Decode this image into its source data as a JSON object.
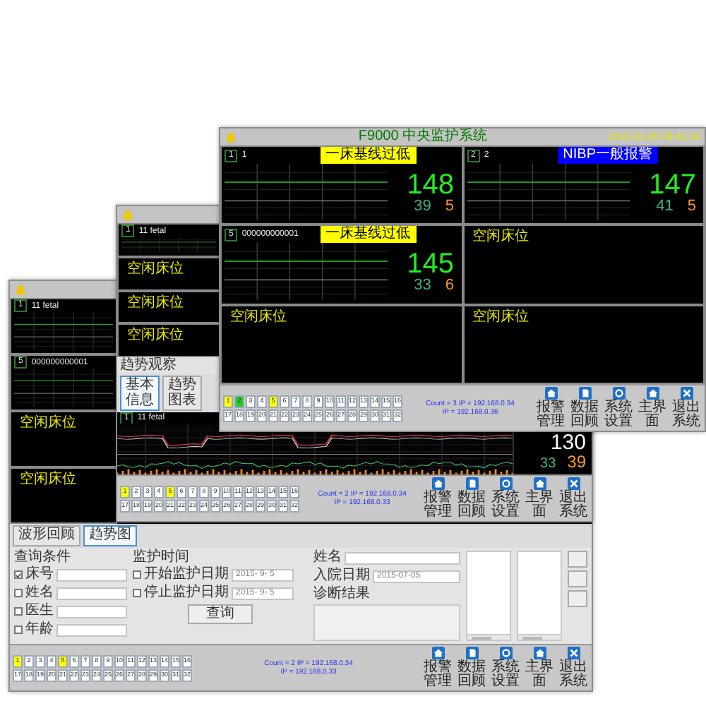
{
  "review_window": {
    "monitor_list": [
      {
        "kind": "active",
        "bed": "1",
        "patient": "11 fetal"
      },
      {
        "kind": "active",
        "bed": "5",
        "patient": "000000000001"
      },
      {
        "kind": "idle",
        "label": "空闲床位"
      },
      {
        "kind": "idle",
        "label": "空闲床位"
      }
    ],
    "tabs": [
      {
        "label": "波形回顾",
        "selected": false
      },
      {
        "label": "趋势图",
        "selected": true
      }
    ],
    "query": {
      "title": "查询条件",
      "fields": [
        {
          "label": "床号",
          "checked": true
        },
        {
          "label": "姓名",
          "checked": false
        },
        {
          "label": "医生",
          "checked": false
        },
        {
          "label": "年龄",
          "checked": false
        }
      ],
      "time_title": "监护时间",
      "dates": [
        {
          "label": "开始监护日期",
          "checked": false,
          "value": "2015- 9- 5"
        },
        {
          "label": "停止监护日期",
          "checked": false,
          "value": "2015- 9- 5"
        }
      ],
      "button": "查询"
    },
    "patient_info": {
      "name_label": "姓名",
      "admit_label": "入院日期",
      "admit_value": "2015-07-05",
      "diagnosis_label": "诊断结果"
    },
    "bed_grid": [
      {
        "label": "1",
        "color": "#ffff00"
      },
      {
        "label": "2",
        "color": "#ffffff"
      },
      {
        "label": "3",
        "color": "#ffffff"
      },
      {
        "label": "4",
        "color": "#ffffff"
      },
      {
        "label": "5",
        "color": "#ffff00"
      },
      {
        "label": "6",
        "color": "#ffffff"
      },
      {
        "label": "7",
        "color": "#ffffff"
      },
      {
        "label": "8",
        "color": "#ffffff"
      },
      {
        "label": "9",
        "color": "#ffffff"
      },
      {
        "label": "10",
        "color": "#ffffff"
      },
      {
        "label": "11",
        "color": "#ffffff"
      },
      {
        "label": "12",
        "color": "#ffffff"
      },
      {
        "label": "13",
        "color": "#ffffff"
      },
      {
        "label": "14",
        "color": "#ffffff"
      },
      {
        "label": "15",
        "color": "#ffffff"
      },
      {
        "label": "16",
        "color": "#ffffff"
      },
      {
        "label": "17",
        "color": "#ffffff"
      },
      {
        "label": "18",
        "color": "#ffffff"
      },
      {
        "label": "19",
        "color": "#ffffff"
      },
      {
        "label": "20",
        "color": "#ffffff"
      },
      {
        "label": "21",
        "color": "#ffffff"
      },
      {
        "label": "22",
        "color": "#ffffff"
      },
      {
        "label": "23",
        "color": "#ffffff"
      },
      {
        "label": "24",
        "color": "#ffffff"
      },
      {
        "label": "25",
        "color": "#ffffff"
      },
      {
        "label": "26",
        "color": "#ffffff"
      },
      {
        "label": "27",
        "color": "#ffffff"
      },
      {
        "label": "28",
        "color": "#ffffff"
      },
      {
        "label": "29",
        "color": "#ffffff"
      },
      {
        "label": "30",
        "color": "#ffffff"
      },
      {
        "label": "31",
        "color": "#ffffff"
      },
      {
        "label": "32",
        "color": "#ffffff"
      }
    ],
    "status": [
      "Count = 2 IP = 192.168.0.34",
      "IP = 192.168.0.33"
    ],
    "buttons": [
      "报警管理",
      "数据回顾",
      "系统设置",
      "主界面",
      "退出系统"
    ]
  },
  "trend_window": {
    "monitor_list": [
      {
        "kind": "active",
        "bed": "1",
        "patient": "11 fetal"
      },
      {
        "kind": "idle",
        "label": "空闲床位"
      },
      {
        "kind": "idle",
        "label": "空闲床位"
      },
      {
        "kind": "idle",
        "label": "空闲床位"
      }
    ],
    "section_title": "趋势观察",
    "tabs": [
      {
        "label": "基本信息",
        "selected": true
      },
      {
        "label": "趋势图表",
        "selected": false
      }
    ],
    "chart_header": {
      "bed": "1",
      "patient": "11 fetal"
    },
    "readout": {
      "fhr": "130",
      "toco": "33",
      "fm": "39"
    },
    "bed_grid": [
      {
        "label": "1",
        "color": "#ffff00"
      },
      {
        "label": "2",
        "color": "#ffffff"
      },
      {
        "label": "3",
        "color": "#ffffff"
      },
      {
        "label": "4",
        "color": "#ffffff"
      },
      {
        "label": "5",
        "color": "#ffff00"
      },
      {
        "label": "6",
        "color": "#ffffff"
      },
      {
        "label": "7",
        "color": "#ffffff"
      },
      {
        "label": "8",
        "color": "#ffffff"
      },
      {
        "label": "9",
        "color": "#ffffff"
      },
      {
        "label": "10",
        "color": "#ffffff"
      },
      {
        "label": "11",
        "color": "#ffffff"
      },
      {
        "label": "12",
        "color": "#ffffff"
      },
      {
        "label": "13",
        "color": "#ffffff"
      },
      {
        "label": "14",
        "color": "#ffffff"
      },
      {
        "label": "15",
        "color": "#ffffff"
      },
      {
        "label": "16",
        "color": "#ffffff"
      },
      {
        "label": "17",
        "color": "#ffffff"
      },
      {
        "label": "18",
        "color": "#ffffff"
      },
      {
        "label": "19",
        "color": "#ffffff"
      },
      {
        "label": "20",
        "color": "#ffffff"
      },
      {
        "label": "21",
        "color": "#ffffff"
      },
      {
        "label": "22",
        "color": "#ffffff"
      },
      {
        "label": "23",
        "color": "#ffffff"
      },
      {
        "label": "24",
        "color": "#ffffff"
      },
      {
        "label": "25",
        "color": "#ffffff"
      },
      {
        "label": "26",
        "color": "#ffffff"
      },
      {
        "label": "27",
        "color": "#ffffff"
      },
      {
        "label": "28",
        "color": "#ffffff"
      },
      {
        "label": "29",
        "color": "#ffffff"
      },
      {
        "label": "30",
        "color": "#ffffff"
      },
      {
        "label": "31",
        "color": "#ffffff"
      },
      {
        "label": "32",
        "color": "#ffffff"
      }
    ],
    "status": [
      "Count = 2 IP = 192.168.0.34",
      "IP = 192.168.0.33"
    ],
    "buttons": [
      "报警管理",
      "数据回顾",
      "系统设置",
      "主界面",
      "退出系统"
    ]
  },
  "central_window": {
    "title": "F9000 中央监护系统",
    "datetime": "2015-01-05 09:41:34",
    "beds": [
      {
        "kind": "active",
        "bed": "1",
        "patient": "1",
        "alarm": "一床基线过低",
        "color": "#ffff00",
        "fhr": "148",
        "toco": "39",
        "fm": "5"
      },
      {
        "kind": "active",
        "bed": "2",
        "patient": "2",
        "alarm": "NIBP一般报警",
        "color": "#0000ff",
        "fhr": "147",
        "toco": "41",
        "fm": "5"
      },
      {
        "kind": "active",
        "bed": "5",
        "patient": "000000000001",
        "alarm": "一床基线过低",
        "color": "#ffff00",
        "fhr": "145",
        "toco": "33",
        "fm": "6"
      },
      {
        "kind": "idle",
        "label": "空闲床位"
      },
      {
        "kind": "idle",
        "label": "空闲床位"
      },
      {
        "kind": "idle",
        "label": "空闲床位"
      }
    ],
    "bed_grid": [
      {
        "label": "1",
        "color": "#ffff00"
      },
      {
        "label": "2",
        "color": "#22cc22"
      },
      {
        "label": "3",
        "color": "#ffffff"
      },
      {
        "label": "4",
        "color": "#ffffff"
      },
      {
        "label": "5",
        "color": "#ffff00"
      },
      {
        "label": "6",
        "color": "#ffffff"
      },
      {
        "label": "7",
        "color": "#ffffff"
      },
      {
        "label": "8",
        "color": "#ffffff"
      },
      {
        "label": "9",
        "color": "#ffffff"
      },
      {
        "label": "10",
        "color": "#ffffff"
      },
      {
        "label": "11",
        "color": "#ffffff"
      },
      {
        "label": "12",
        "color": "#ffffff"
      },
      {
        "label": "13",
        "color": "#ffffff"
      },
      {
        "label": "14",
        "color": "#ffffff"
      },
      {
        "label": "15",
        "color": "#ffffff"
      },
      {
        "label": "16",
        "color": "#ffffff"
      },
      {
        "label": "17",
        "color": "#ffffff"
      },
      {
        "label": "18",
        "color": "#ffffff"
      },
      {
        "label": "19",
        "color": "#ffffff"
      },
      {
        "label": "20",
        "color": "#ffffff"
      },
      {
        "label": "21",
        "color": "#ffffff"
      },
      {
        "label": "22",
        "color": "#ffffff"
      },
      {
        "label": "23",
        "color": "#ffffff"
      },
      {
        "label": "24",
        "color": "#ffffff"
      },
      {
        "label": "25",
        "color": "#ffffff"
      },
      {
        "label": "26",
        "color": "#ffffff"
      },
      {
        "label": "27",
        "color": "#ffffff"
      },
      {
        "label": "28",
        "color": "#ffffff"
      },
      {
        "label": "29",
        "color": "#ffffff"
      },
      {
        "label": "30",
        "color": "#ffffff"
      },
      {
        "label": "31",
        "color": "#ffffff"
      },
      {
        "label": "32",
        "color": "#ffffff"
      }
    ],
    "status": [
      "Count = 3 IP = 192.168.0.34",
      "IP = 192.168.0.36"
    ],
    "buttons": [
      "报警管理",
      "数据回顾",
      "系统设置",
      "主界面",
      "退出系统"
    ]
  }
}
